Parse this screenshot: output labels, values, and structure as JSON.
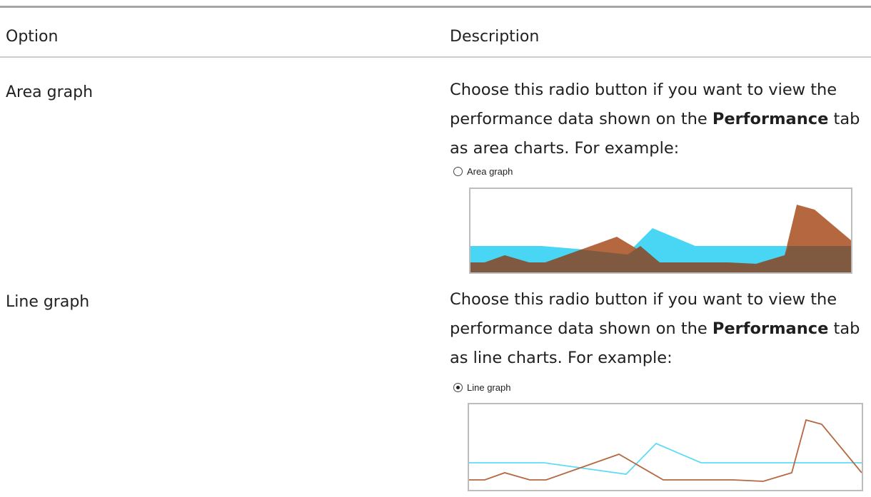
{
  "table": {
    "headers": {
      "option": "Option",
      "description": "Description"
    },
    "rows": [
      {
        "option": "Area graph",
        "description_pre": "Choose this radio button if you want to view the performance data shown on the ",
        "description_bold": "Performance",
        "description_post": " tab as area charts. For example:",
        "example": {
          "radio_label": "Area graph",
          "radio_selected": false
        }
      },
      {
        "option": "Line graph",
        "description_pre": "Choose this radio button if you want to view the performance data shown on the ",
        "description_bold": "Performance",
        "description_post": " tab as line charts. For example:",
        "example": {
          "radio_label": "Line graph",
          "radio_selected": true
        }
      }
    ]
  },
  "colors": {
    "cyan_series": "#49d6f4",
    "orange_series": "#b5673f",
    "overlap": "#7f5a41",
    "rule": "#a6a6a6",
    "row_divider": "#cccccc"
  }
}
